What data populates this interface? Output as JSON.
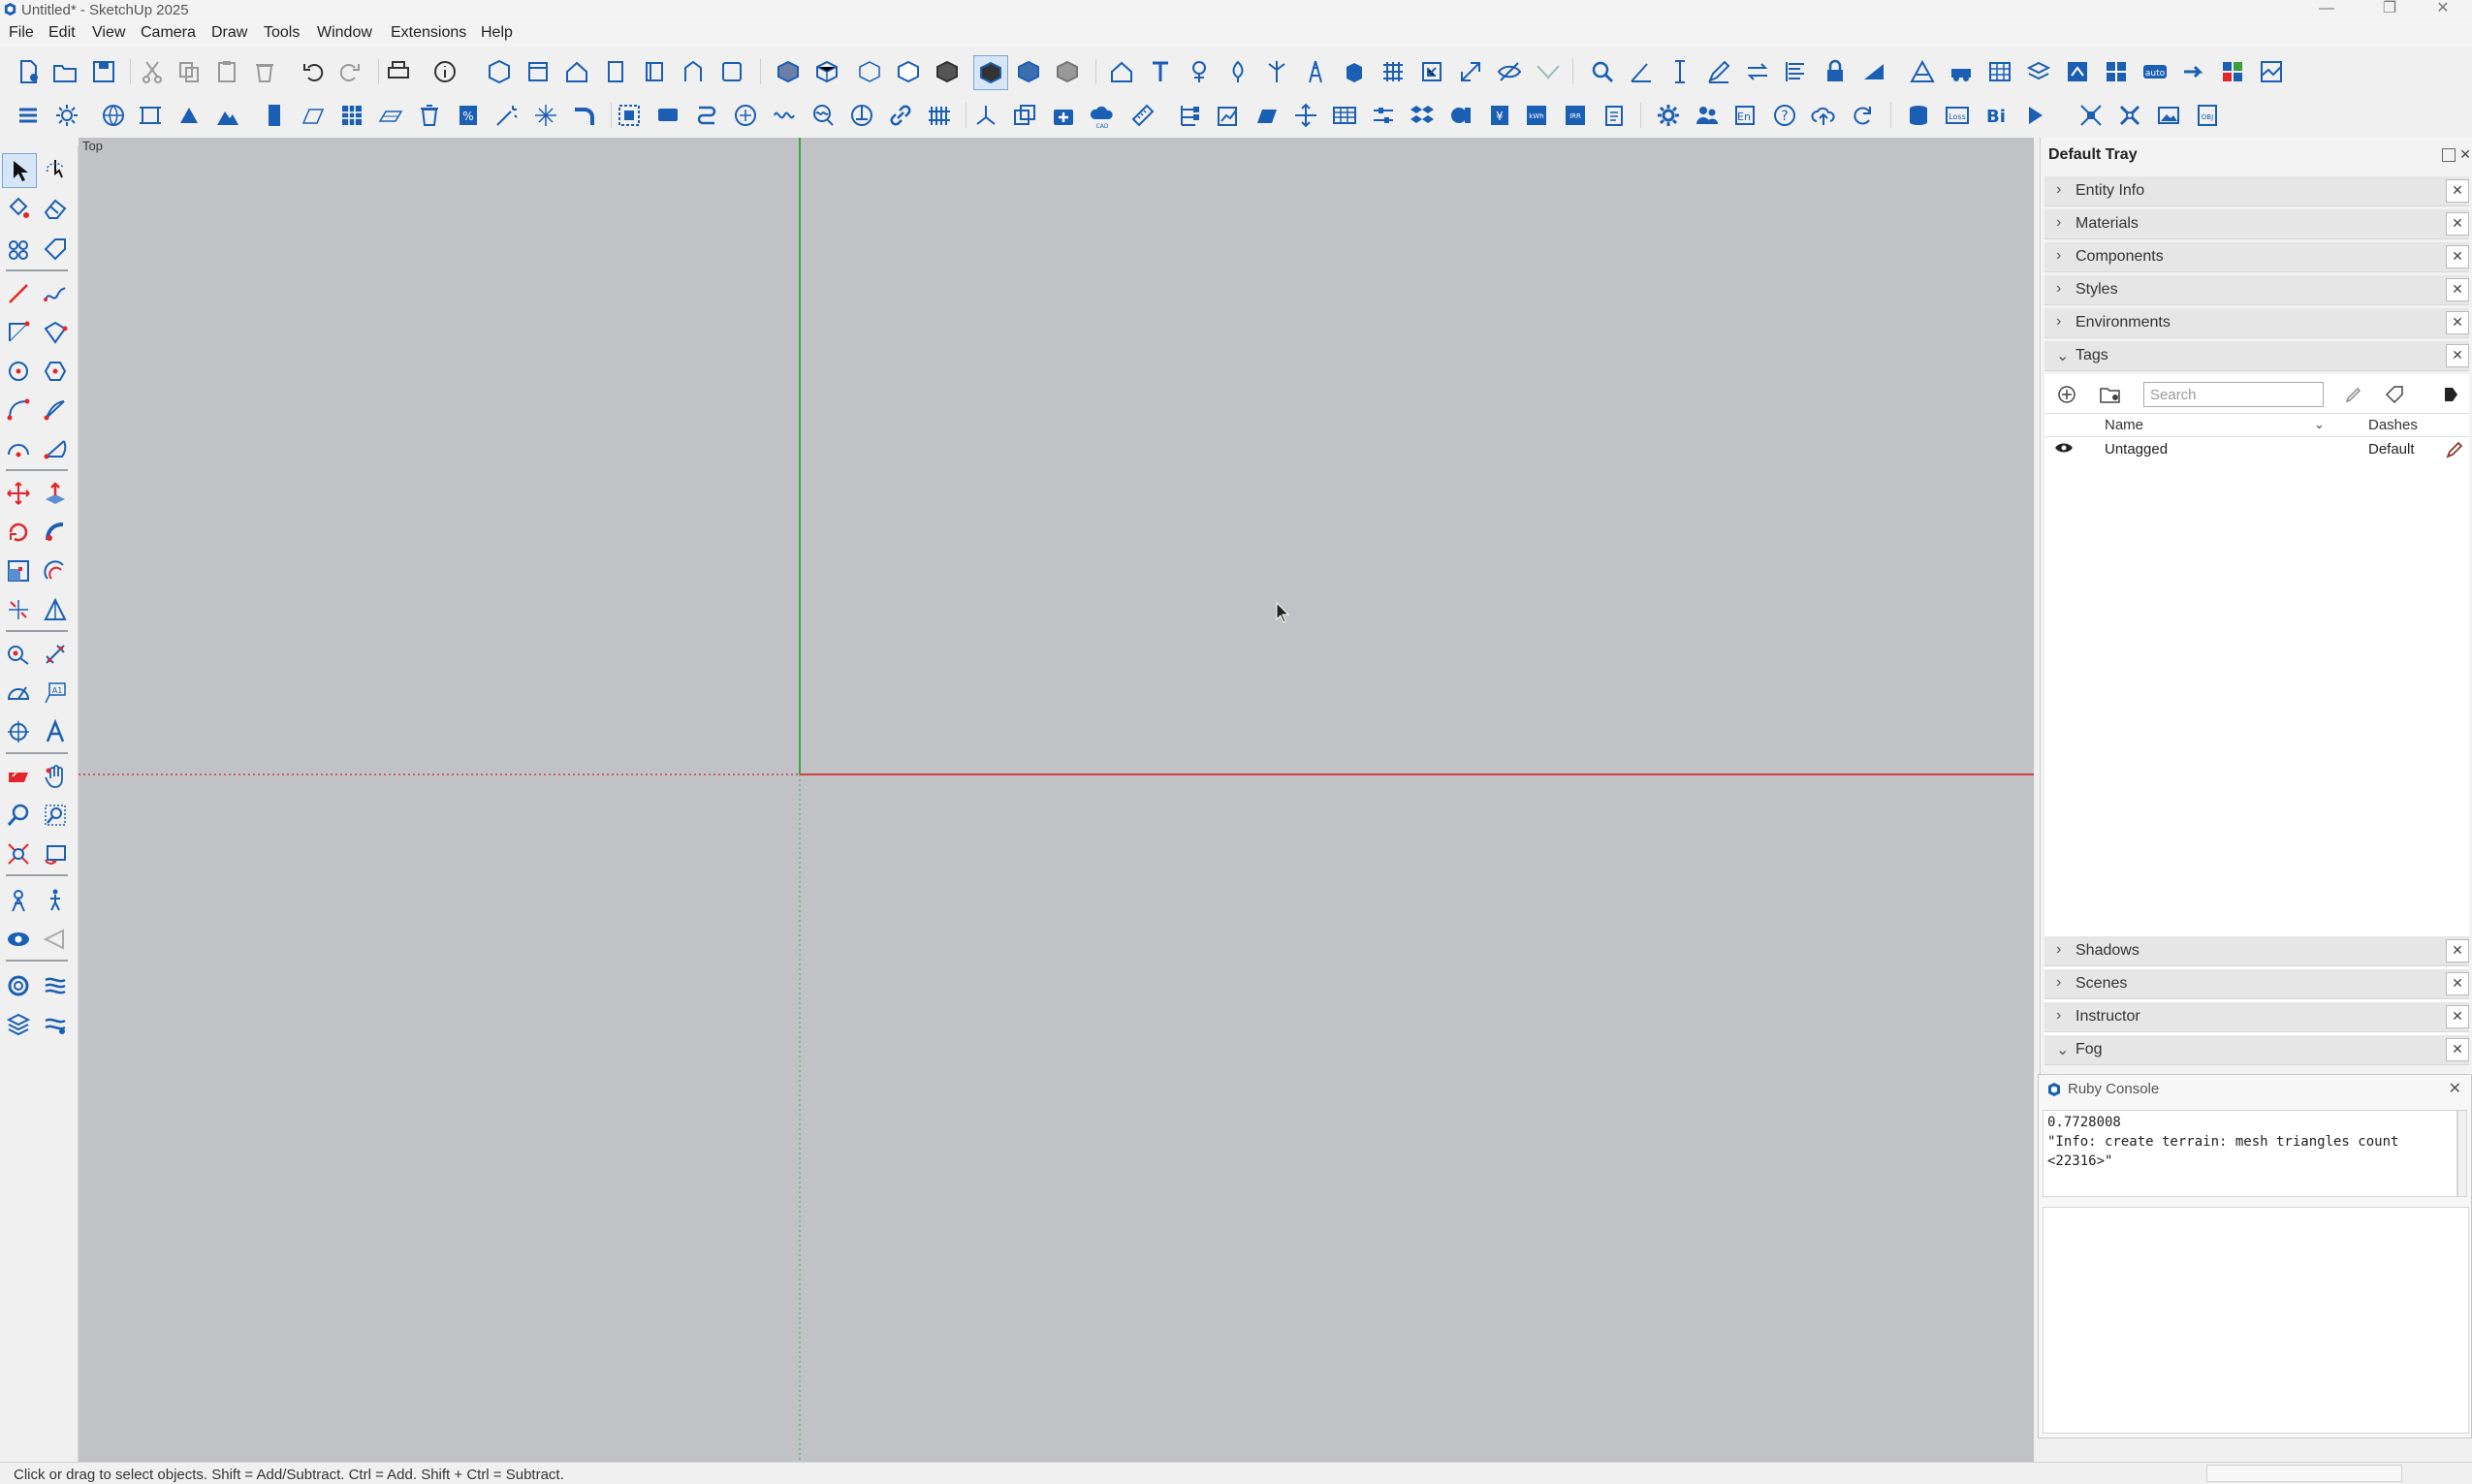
{
  "window": {
    "title": "Untitled* - SketchUp 2025",
    "controls": {
      "minimize": "—",
      "maximize": "❐",
      "close": "✕"
    }
  },
  "menu": [
    "File",
    "Edit",
    "View",
    "Camera",
    "Draw",
    "Tools",
    "Window",
    "Extensions",
    "Help"
  ],
  "viewport": {
    "view_name": "Top"
  },
  "tray": {
    "title": "Default Tray",
    "panels_top": [
      {
        "label": "Entity Info",
        "expanded": false
      },
      {
        "label": "Materials",
        "expanded": false
      },
      {
        "label": "Components",
        "expanded": false
      },
      {
        "label": "Styles",
        "expanded": false
      },
      {
        "label": "Environments",
        "expanded": false
      },
      {
        "label": "Tags",
        "expanded": true
      }
    ],
    "tags": {
      "search_placeholder": "Search",
      "col_name": "Name",
      "col_dashes": "Dashes",
      "rows": [
        {
          "name": "Untagged",
          "dashes": "Default"
        }
      ]
    },
    "panels_bottom": [
      {
        "label": "Shadows",
        "expanded": false
      },
      {
        "label": "Scenes",
        "expanded": false
      },
      {
        "label": "Instructor",
        "expanded": false
      },
      {
        "label": "Fog",
        "expanded": true
      }
    ]
  },
  "ruby_console": {
    "title": "Ruby Console",
    "output": "0.7728008\n\"Info: create terrain: mesh triangles count\n<22316>\""
  },
  "status": {
    "text": "Click or drag to select objects. Shift = Add/Subtract. Ctrl = Add. Shift + Ctrl = Subtract."
  },
  "colors": {
    "accent": "#1a5fb4",
    "red": "#e3262c",
    "viewport": "#c1c2c6",
    "axis_green": "#3daa3d",
    "axis_red": "#d04040"
  }
}
